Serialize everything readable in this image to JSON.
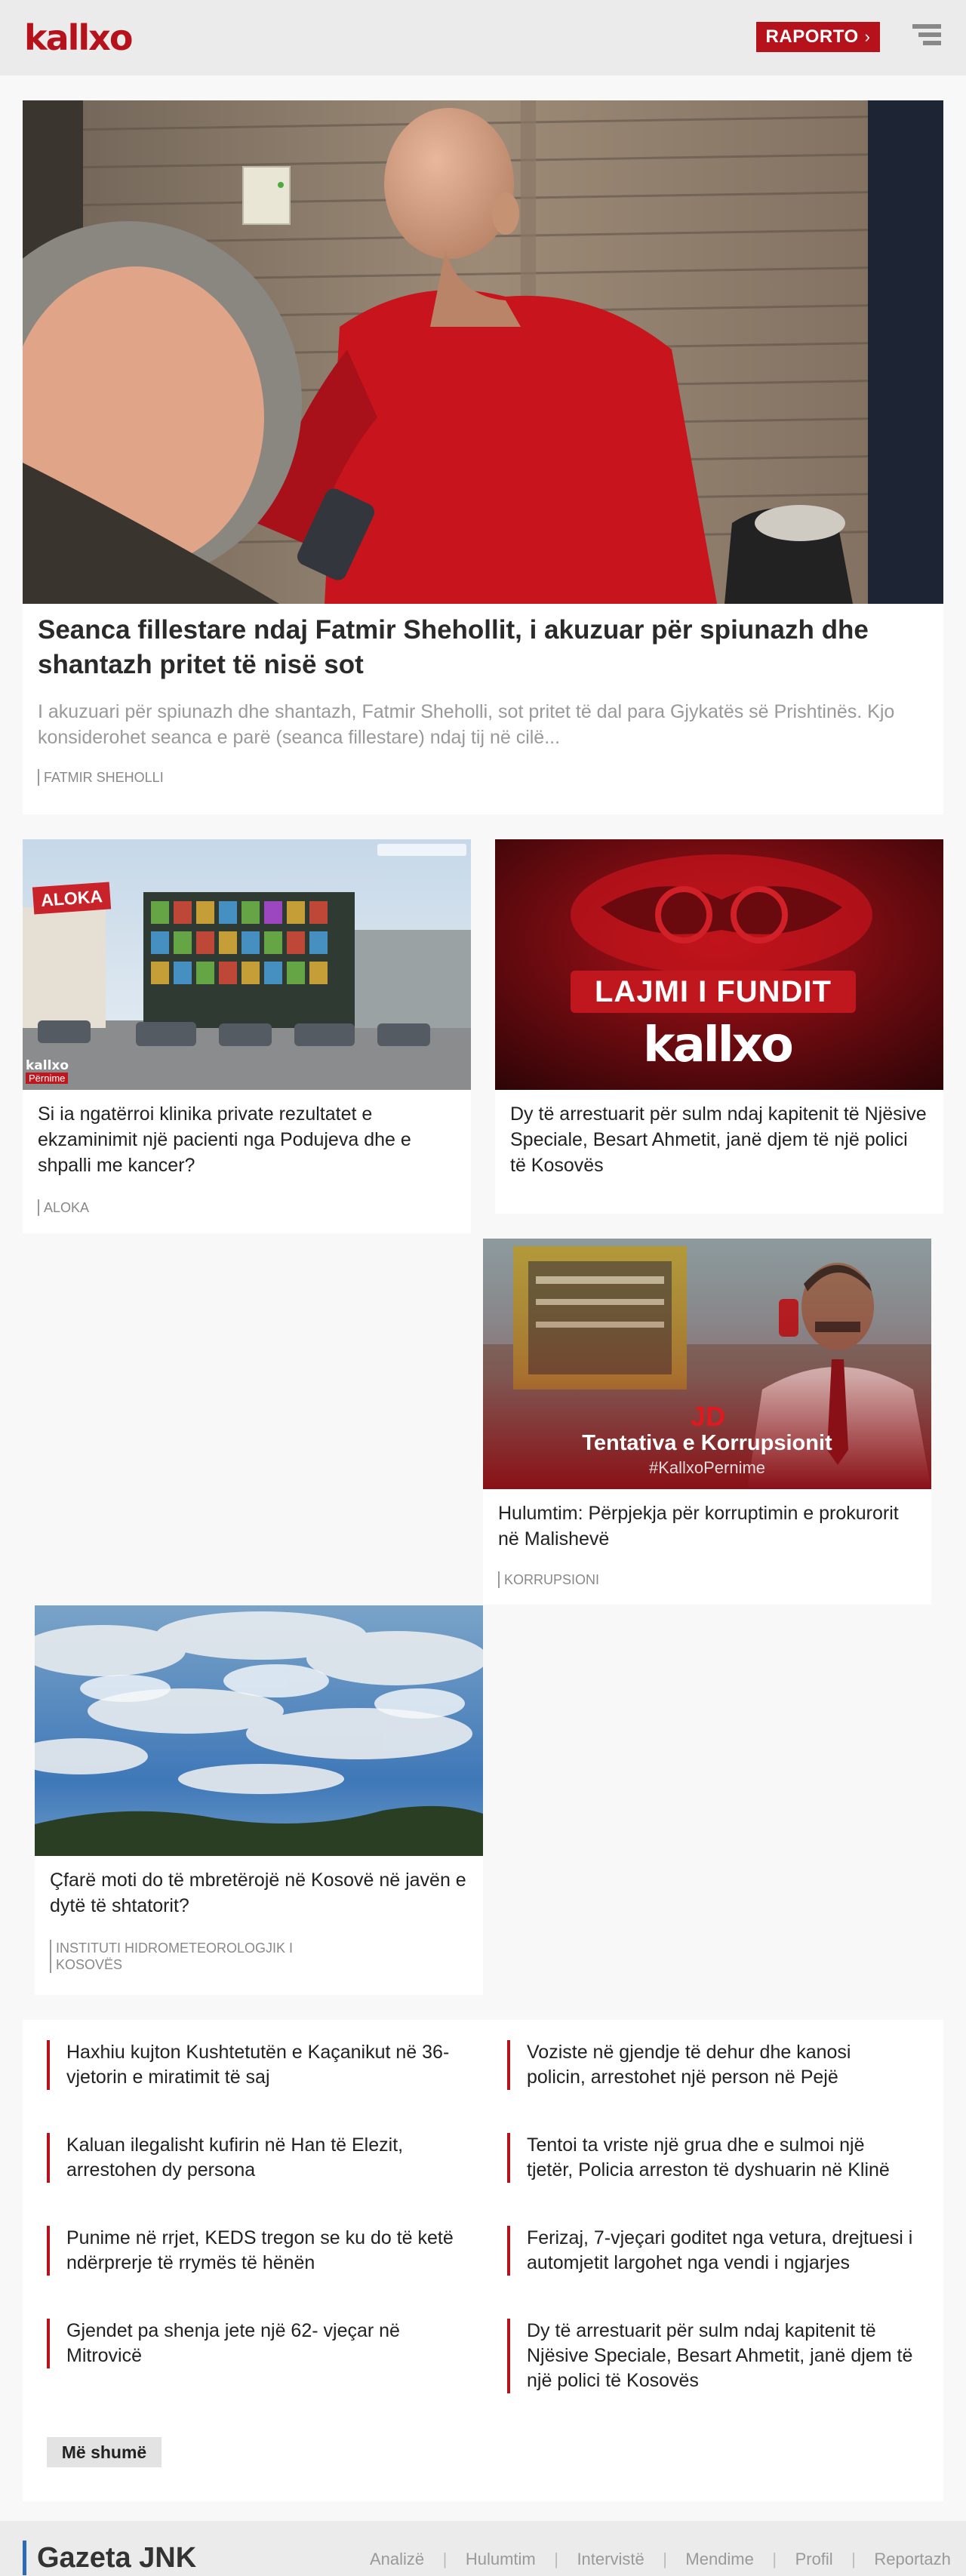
{
  "header": {
    "logo": "kallxo",
    "report_button": "RAPORTO",
    "report_chevron": "›",
    "brand_color": "#b5121b"
  },
  "lead": {
    "title": "Seanca fillestare ndaj Fatmir Shehollit, i akuzuar për spiunazh dhe shantazh pritet të nisë sot",
    "excerpt": "I akuzuari për spiunazh dhe shantazh, Fatmir Sheholli, sot pritet të dal para Gjykatës së Prishtinës. Kjo konsiderohet seanca e parë (seanca fillestare) ndaj tij në cilë...",
    "tag": "FATMIR SHEHOLLI"
  },
  "articles": [
    {
      "title": "Si ia ngatërroi klinika private rezultatet e ekzaminimit një pacienti nga Podujeva dhe e shpalli me kancer?",
      "tag": "ALOKA",
      "image_sign": "ALOKA",
      "image_logo": "kallxo",
      "image_badge": "Përnime"
    },
    {
      "title": "Dy të arrestuarit për sulm ndaj kapitenit të Njësive Speciale, Besart Ahmetit, janë djem të një polici të Kosovës",
      "image_banner": "LAJMI I FUNDIT",
      "image_logo": "kallxo"
    },
    {
      "title": "Hulumtim: Përpjekja për korruptimin e prokurorit në Malishevë",
      "tag": "KORRUPSIONI",
      "image_heading": "Tentativa e Korrupsionit",
      "image_hashtag": "#KallxoPernime",
      "image_mark": "JD"
    },
    {
      "title": "Çfarë moti do të mbretërojë në Kosovë në javën e dytë të shtatorit?",
      "tag": "INSTITUTI HIDROMETEOROLOGJIK I KOSOVËS"
    }
  ],
  "latest": [
    "Haxhiu kujton Kushtetutën e Kaçanikut në 36-vjetorin e miratimit të saj",
    "Voziste në gjendje të dehur dhe kanosi policin, arrestohet një person në Pejë",
    "Kaluan ilegalisht kufirin në Han të Elezit, arrestohen dy persona",
    "Tentoi ta vriste një grua dhe e sulmoi një tjetër, Policia arreston të dyshuarin në Klinë",
    "Punime në rrjet, KEDS tregon se ku do të ketë ndërprerje të rrymës të hënën",
    "Ferizaj, 7-vjeçari goditet nga vetura, drejtuesi i automjetit largohet nga vendi i ngjarjes",
    "Gjendet pa shenja jete një 62- vjeçar në Mitrovicë",
    "Dy të arrestuarit për sulm ndaj kapitenit të Njësive Speciale, Besart Ahmetit, janë djem të një polici të Kosovës"
  ],
  "more_button": "Më shumë",
  "footer": {
    "brand": "Gazeta JNK",
    "nav": [
      "Analizë",
      "Hulumtim",
      "Intervistë",
      "Mendime",
      "Profil",
      "Reportazh"
    ],
    "separator": "|",
    "brand_accent": "#2d6cb5"
  }
}
